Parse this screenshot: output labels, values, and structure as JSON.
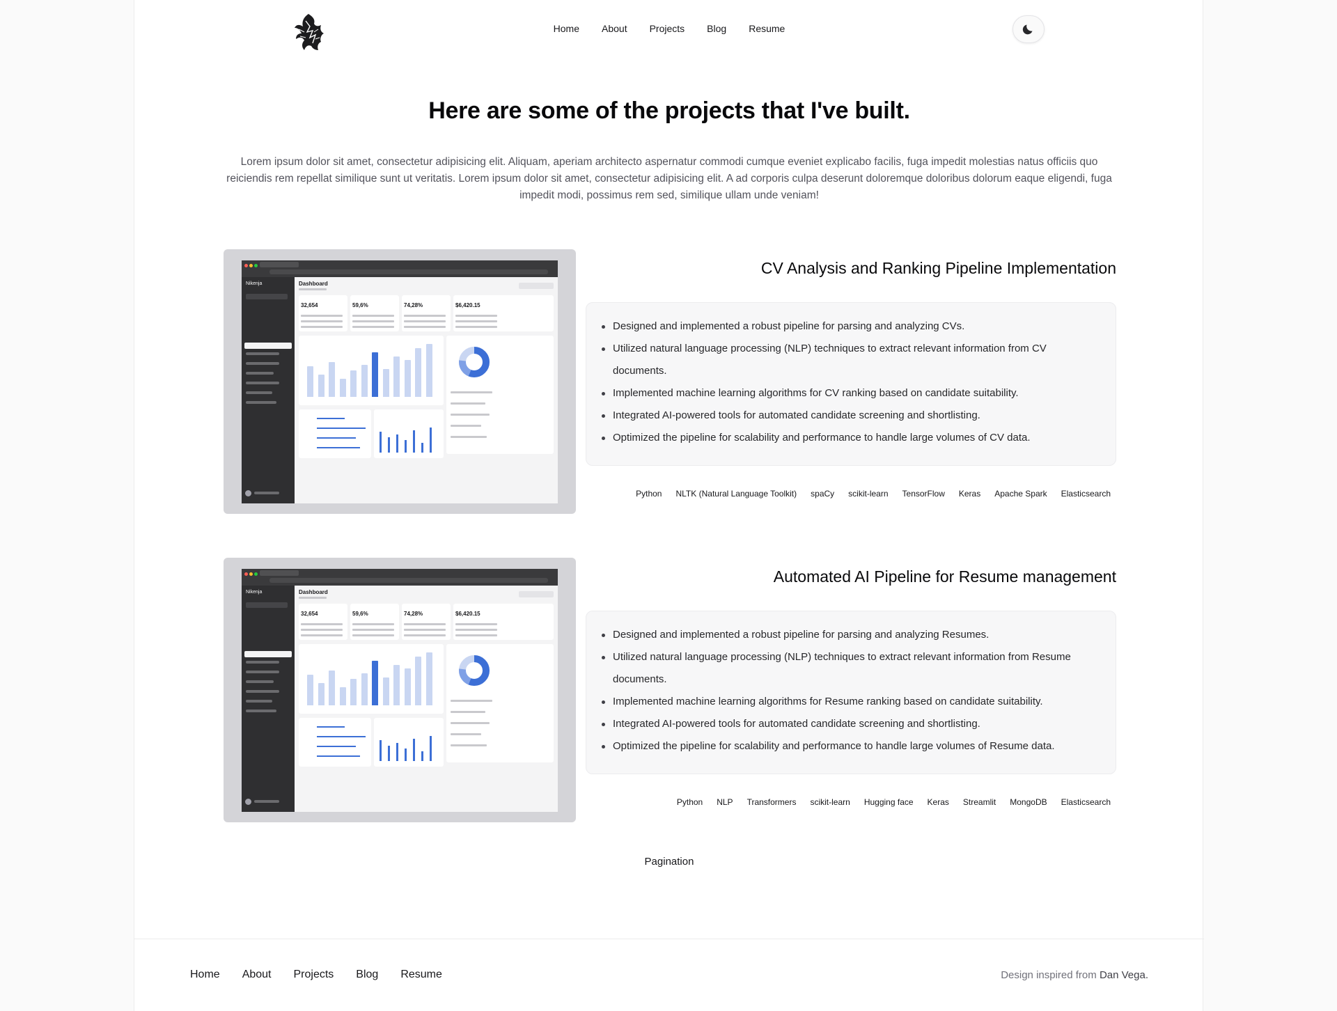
{
  "header": {
    "nav": [
      "Home",
      "About",
      "Projects",
      "Blog",
      "Resume"
    ],
    "theme_icon": "moon-icon",
    "logo_icon": "phoenix-logo-icon"
  },
  "page": {
    "title": "Here are some of the projects that I've built.",
    "intro": "Lorem ipsum dolor sit amet, consectetur adipisicing elit. Aliquam, aperiam architecto aspernatur commodi cumque eveniet explicabo facilis, fuga impedit molestias natus officiis quo reiciendis rem repellat similique sunt ut veritatis. Lorem ipsum dolor sit amet, consectetur adipisicing elit. A ad corporis culpa deserunt doloremque doloribus dolorum eaque eligendi, fuga impedit modi, possimus rem sed, similique ullam unde veniam!"
  },
  "projects": [
    {
      "title": "CV Analysis and Ranking Pipeline Implementation",
      "bullets": [
        "Designed and implemented a robust pipeline for parsing and analyzing CVs.",
        "Utilized natural language processing (NLP) techniques to extract relevant information from CV documents.",
        "Implemented machine learning algorithms for CV ranking based on candidate suitability.",
        "Integrated AI-powered tools for automated candidate screening and shortlisting.",
        "Optimized the pipeline for scalability and performance to handle large volumes of CV data."
      ],
      "tags": [
        "Python",
        "NLTK (Natural Language Toolkit)",
        "spaCy",
        "scikit-learn",
        "TensorFlow",
        "Keras",
        "Apache Spark",
        "Elasticsearch"
      ]
    },
    {
      "title": "Automated AI Pipeline for Resume management",
      "bullets": [
        "Designed and implemented a robust pipeline for parsing and analyzing Resumes.",
        "Utilized natural language processing (NLP) techniques to extract relevant information from Resume documents.",
        "Implemented machine learning algorithms for Resume ranking based on candidate suitability.",
        "Integrated AI-powered tools for automated candidate screening and shortlisting.",
        "Optimized the pipeline for scalability and performance to handle large volumes of Resume data."
      ],
      "tags": [
        "Python",
        "NLP",
        "Transformers",
        "scikit-learn",
        "Hugging face",
        "Keras",
        "Streamlit",
        "MongoDB",
        "Elasticsearch"
      ]
    }
  ],
  "screenshot": {
    "app_name": "Nikenja",
    "heading": "Dashboard",
    "stats": [
      "32,654",
      "59,6%",
      "74,28%",
      "$6,420.15"
    ],
    "bar_levels": [
      0.55,
      0.4,
      0.62,
      0.32,
      0.48,
      0.58,
      0.8,
      0.5,
      0.72,
      0.66,
      0.88,
      0.95
    ]
  },
  "pagination": {
    "label": "Pagination"
  },
  "footer": {
    "nav": [
      "Home",
      "About",
      "Projects",
      "Blog",
      "Resume"
    ],
    "credit_prefix": "Design inspired from ",
    "credit_link": "Dan Vega."
  }
}
